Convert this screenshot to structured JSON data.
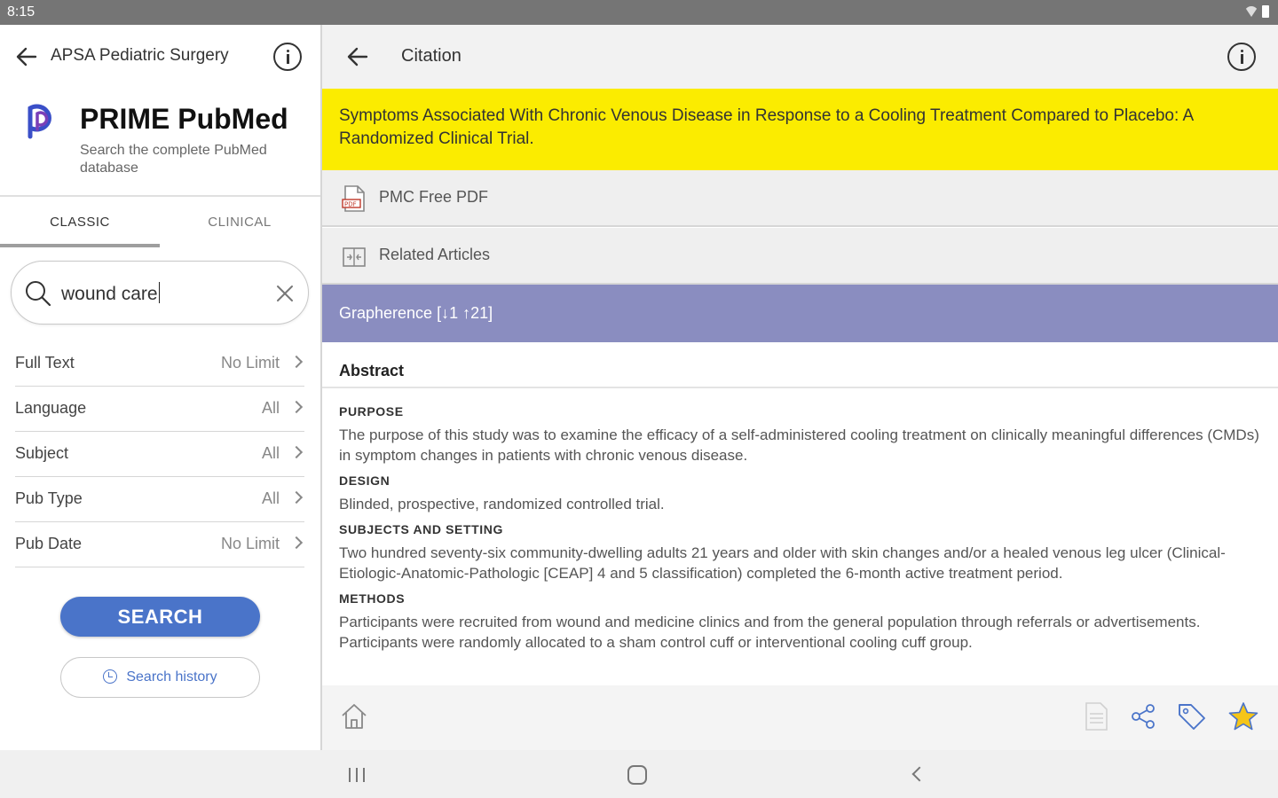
{
  "status_bar": {
    "time": "8:15"
  },
  "left_panel": {
    "header_title": "APSA Pediatric Surgery",
    "brand": {
      "title": "PRIME PubMed",
      "subtitle": "Search the complete PubMed database"
    },
    "tabs": [
      {
        "label": "CLASSIC",
        "selected": true
      },
      {
        "label": "CLINICAL",
        "selected": false
      }
    ],
    "search": {
      "value": "wound care"
    },
    "filters": [
      {
        "label": "Full Text",
        "value": "No Limit"
      },
      {
        "label": "Language",
        "value": "All"
      },
      {
        "label": "Subject",
        "value": "All"
      },
      {
        "label": "Pub Type",
        "value": "All"
      },
      {
        "label": "Pub Date",
        "value": "No Limit"
      }
    ],
    "search_button": "SEARCH",
    "history_button": "Search history"
  },
  "right_panel": {
    "header_title": "Citation",
    "article_title": "Symptoms Associated With Chronic Venous Disease in Response to a Cooling Treatment Compared to Placebo: A Randomized Clinical Trial.",
    "links": [
      {
        "label": "PMC Free PDF",
        "icon": "pdf-icon"
      },
      {
        "label": "Related Articles",
        "icon": "related-articles-icon"
      }
    ],
    "grapherence": "Grapherence [↓1 ↑21]",
    "abstract_heading": "Abstract",
    "abstract_sections": [
      {
        "heading": "PURPOSE",
        "text": "The purpose of this study was to examine the efficacy of a self-administered cooling treatment on clinically meaningful differences (CMDs) in symptom changes in patients with chronic venous disease."
      },
      {
        "heading": "DESIGN",
        "text": "Blinded, prospective, randomized controlled trial."
      },
      {
        "heading": "SUBJECTS AND SETTING",
        "text": "Two hundred seventy-six community-dwelling adults 21 years and older with skin changes and/or a healed venous leg ulcer (Clinical-Etiologic-Anatomic-Pathologic [CEAP] 4 and 5 classification) completed the 6-month active treatment period."
      },
      {
        "heading": "METHODS",
        "text": "Participants were recruited from wound and medicine clinics and from the general population through referrals or advertisements. Participants were randomly allocated to a sham control cuff or interventional cooling cuff group."
      }
    ],
    "bottom_bar_icons": [
      "home-icon",
      "document-icon",
      "share-icon",
      "tag-icon",
      "star-icon"
    ]
  },
  "colors": {
    "title_highlight": "#fbec00",
    "grapherence_bar": "#8a8dc0",
    "primary_button": "#4a74c9",
    "star": "#f5c518"
  }
}
